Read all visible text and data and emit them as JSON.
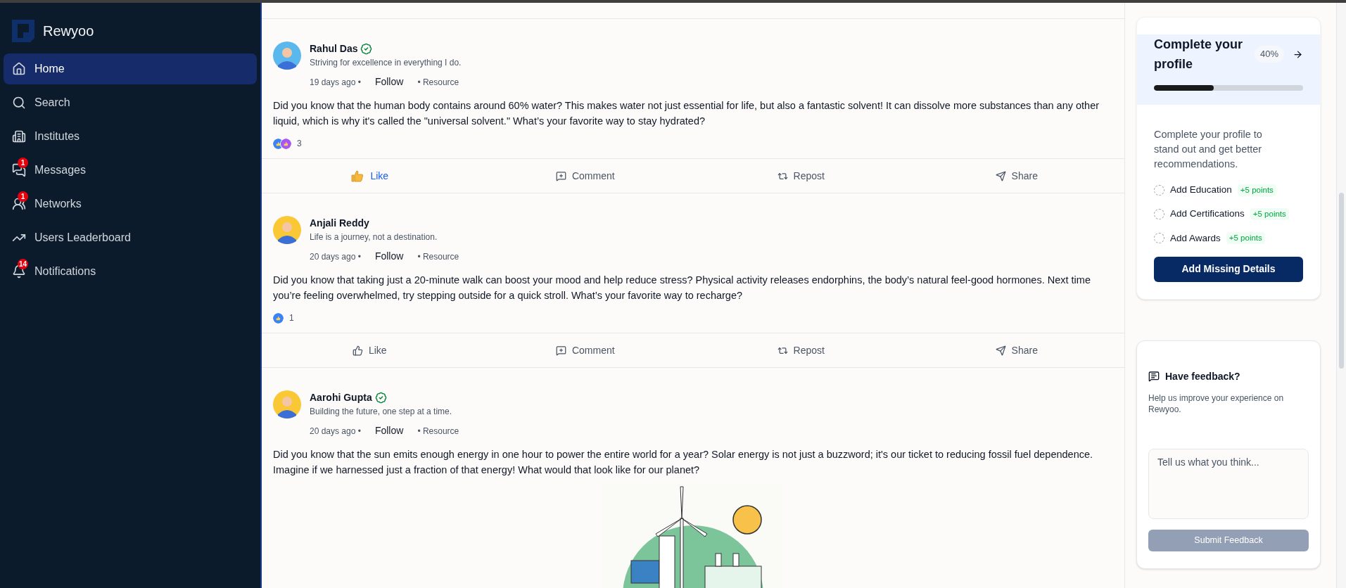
{
  "brand": {
    "name": "Rewyoo"
  },
  "sidebar": {
    "items": [
      {
        "kind": "home",
        "label": "Home",
        "selected": true
      },
      {
        "kind": "search",
        "label": "Search",
        "selected": false
      },
      {
        "kind": "institutes",
        "label": "Institutes",
        "selected": false
      },
      {
        "kind": "messages",
        "label": "Messages",
        "selected": false,
        "badge": "1"
      },
      {
        "kind": "networks",
        "label": "Networks",
        "selected": false,
        "badge": "1"
      },
      {
        "kind": "leaderboard",
        "label": "Users Leaderboard",
        "selected": false
      },
      {
        "kind": "notifications",
        "label": "Notifications",
        "selected": false,
        "badge": "14"
      }
    ]
  },
  "posts": [
    {
      "author": "Rahul Das",
      "verified": true,
      "color": "#5bb8ec",
      "tagline": "Striving for excellence in everything I do.",
      "time": "19 days ago •",
      "follow": "Follow",
      "category": "• Resource",
      "text": "Did you know that the human body contains around 60% water? This makes water not just essential for life, but also a fantastic solvent! It can dissolve more substances than any other liquid, which is why it's called the \"universal solvent.\" What’s your favorite way to stay hydrated?",
      "reactions": [
        {
          "kind": "like"
        },
        {
          "kind": "celebrate"
        }
      ],
      "reaction_count": "3",
      "liked": true,
      "actions": [
        "Like",
        "Comment",
        "Repost",
        "Share"
      ]
    },
    {
      "author": "Anjali Reddy",
      "verified": false,
      "color": "#f9c834",
      "tagline": "Life is a journey, not a destination.",
      "time": "20 days ago •",
      "follow": "Follow",
      "category": "• Resource",
      "text": "Did you know that taking just a 20-minute walk can boost your mood and help reduce stress? Physical activity releases endorphins, the body’s natural feel-good hormones. Next time you’re feeling overwhelmed, try stepping outside for a quick stroll. What’s your favorite way to recharge?",
      "reactions": [
        {
          "kind": "like"
        }
      ],
      "reaction_count": "1",
      "liked": false,
      "actions": [
        "Like",
        "Comment",
        "Repost",
        "Share"
      ]
    },
    {
      "author": "Aarohi Gupta",
      "verified": true,
      "color": "#f9c834",
      "tagline": "Building the future, one step at a time.",
      "time": "20 days ago •",
      "follow": "Follow",
      "category": "• Resource",
      "text": "Did you know that the sun emits enough energy in one hour to power the entire world for a year? Solar energy is not just a buzzword; it's our ticket to reducing fossil fuel dependence. Imagine if we harnessed just a fraction of that energy! What would that look like for our planet?",
      "has_image": true
    }
  ],
  "profile_card": {
    "title": "Complete your profile",
    "percent": "40%",
    "level": 0.4,
    "description": "Complete your profile to stand out and get better recommendations.",
    "tasks": [
      {
        "label": "Add Education",
        "points": "+5 points",
        "checked": false
      },
      {
        "label": "Add Certifications",
        "points": "+5 points",
        "checked": false
      },
      {
        "label": "Add Awards",
        "points": "+5 points",
        "checked": false
      }
    ],
    "button": "Add Missing Details"
  },
  "feedback": {
    "title": "Have feedback?",
    "description": "Help us improve your experience on Rewyoo.",
    "placeholder": "Tell us what you think...",
    "button": "Submit Feedback",
    "disabled": true
  }
}
